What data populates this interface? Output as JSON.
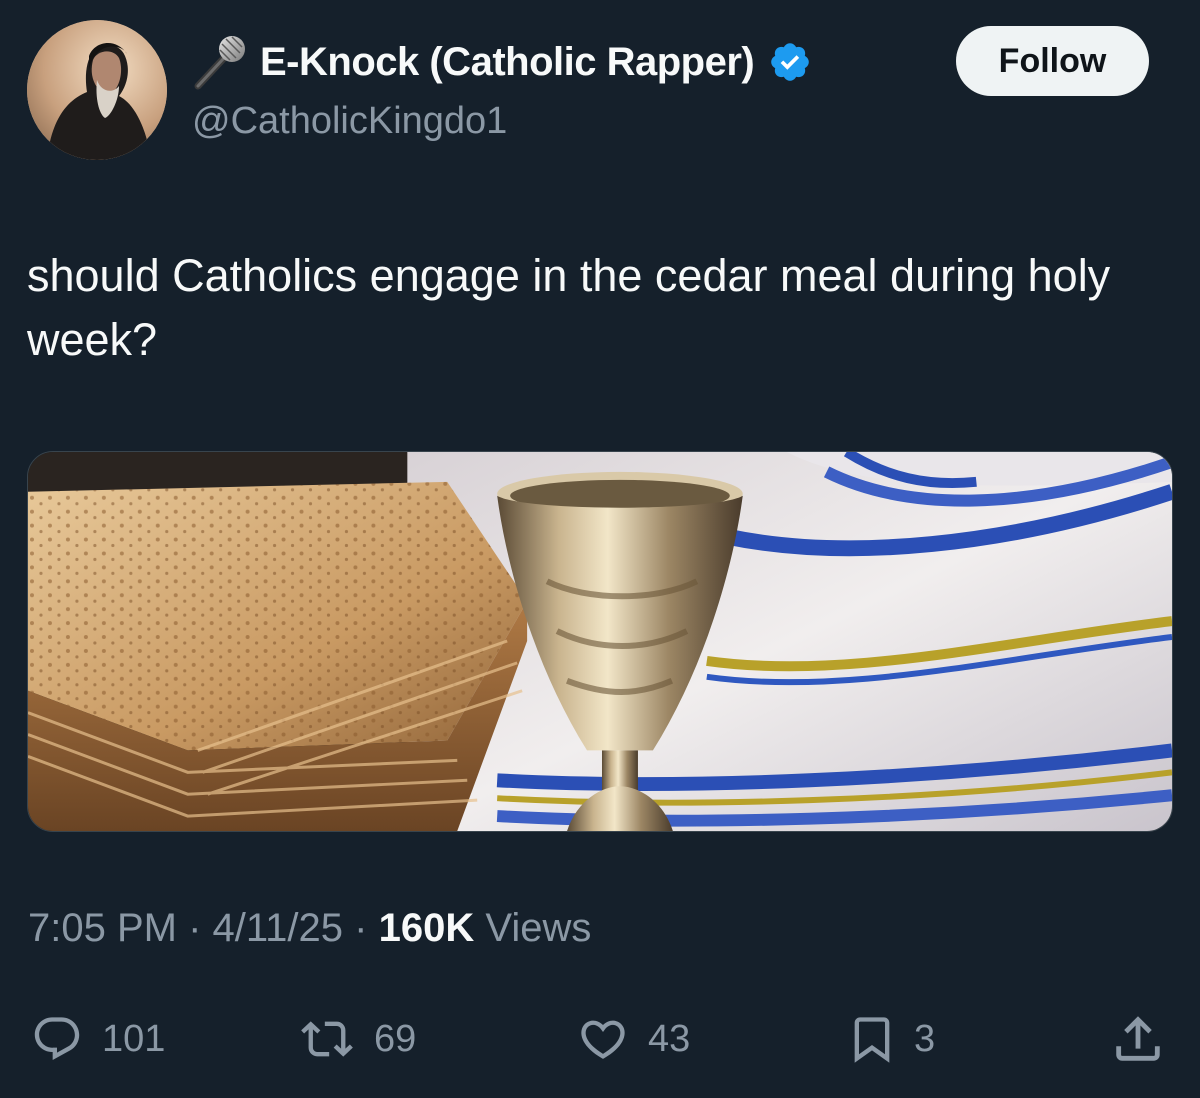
{
  "author": {
    "display_name": "E-Knock (Catholic Rapper)",
    "handle": "@CatholicKingdo1",
    "name_prefix_icon": "microphone-icon",
    "verified": true,
    "verified_color": "#1d9bf0"
  },
  "follow_button": {
    "label": "Follow"
  },
  "tweet": {
    "text": "should Catholics engage in the cedar meal during holy week?",
    "media_description_icon": "matzah-kiddush-cup-tallit-photo"
  },
  "meta": {
    "time": "7:05 PM",
    "separator": "·",
    "date": "4/11/25",
    "views_count": "160K",
    "views_label": "Views"
  },
  "actions": {
    "replies": "101",
    "reposts": "69",
    "likes": "43",
    "bookmarks": "3"
  },
  "colors": {
    "background": "#15202b",
    "text_primary": "#f7f9f9",
    "text_secondary": "#8b98a5",
    "follow_button_bg": "#eff3f4"
  }
}
